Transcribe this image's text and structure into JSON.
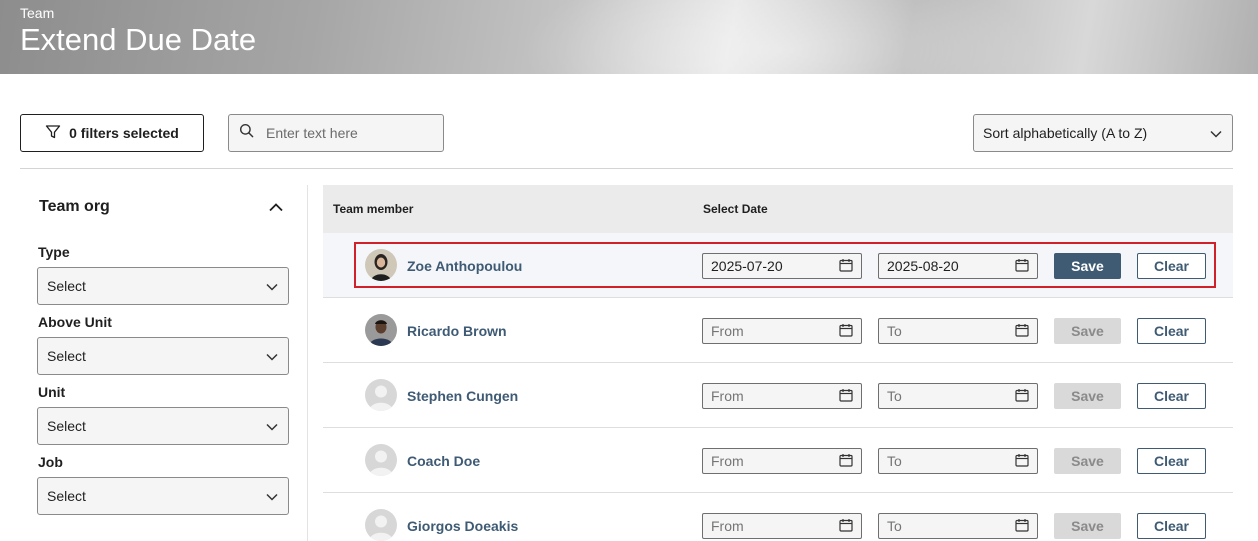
{
  "banner": {
    "subtitle": "Team",
    "title": "Extend Due Date"
  },
  "toolbar": {
    "filters_label": "0 filters selected",
    "search_placeholder": "Enter text here",
    "sort_value": "Sort alphabetically (A to Z)"
  },
  "sidebar": {
    "heading": "Team org",
    "fields": [
      {
        "label": "Type",
        "value": "Select"
      },
      {
        "label": "Above Unit",
        "value": "Select"
      },
      {
        "label": "Unit",
        "value": "Select"
      },
      {
        "label": "Job",
        "value": "Select"
      }
    ]
  },
  "table": {
    "headers": {
      "member": "Team member",
      "date": "Select Date"
    },
    "save_label": "Save",
    "clear_label": "Clear",
    "rows": [
      {
        "name": "Zoe Anthopoulou",
        "from": "2025-07-20",
        "to": "2025-08-20",
        "from_placeholder": "From",
        "to_placeholder": "To",
        "save_enabled": true,
        "highlighted": true,
        "avatar": "photo-female"
      },
      {
        "name": "Ricardo Brown",
        "from": "",
        "to": "",
        "from_placeholder": "From",
        "to_placeholder": "To",
        "save_enabled": false,
        "highlighted": false,
        "avatar": "photo-male"
      },
      {
        "name": "Stephen Cungen",
        "from": "",
        "to": "",
        "from_placeholder": "From",
        "to_placeholder": "To",
        "save_enabled": false,
        "highlighted": false,
        "avatar": "placeholder"
      },
      {
        "name": "Coach Doe",
        "from": "",
        "to": "",
        "from_placeholder": "From",
        "to_placeholder": "To",
        "save_enabled": false,
        "highlighted": false,
        "avatar": "placeholder"
      },
      {
        "name": "Giorgos Doeakis",
        "from": "",
        "to": "",
        "from_placeholder": "From",
        "to_placeholder": "To",
        "save_enabled": false,
        "highlighted": false,
        "avatar": "placeholder"
      }
    ]
  },
  "colors": {
    "accent": "#3f5b74",
    "member_name": "#3e5a74",
    "highlight_border": "#d0202a",
    "save_disabled_bg": "#d9d9d9"
  },
  "icons": {
    "filter": "filter-icon",
    "search": "search-icon",
    "chevron": "chevron-down-icon",
    "collapse": "chevron-up-icon",
    "calendar": "calendar-icon"
  }
}
